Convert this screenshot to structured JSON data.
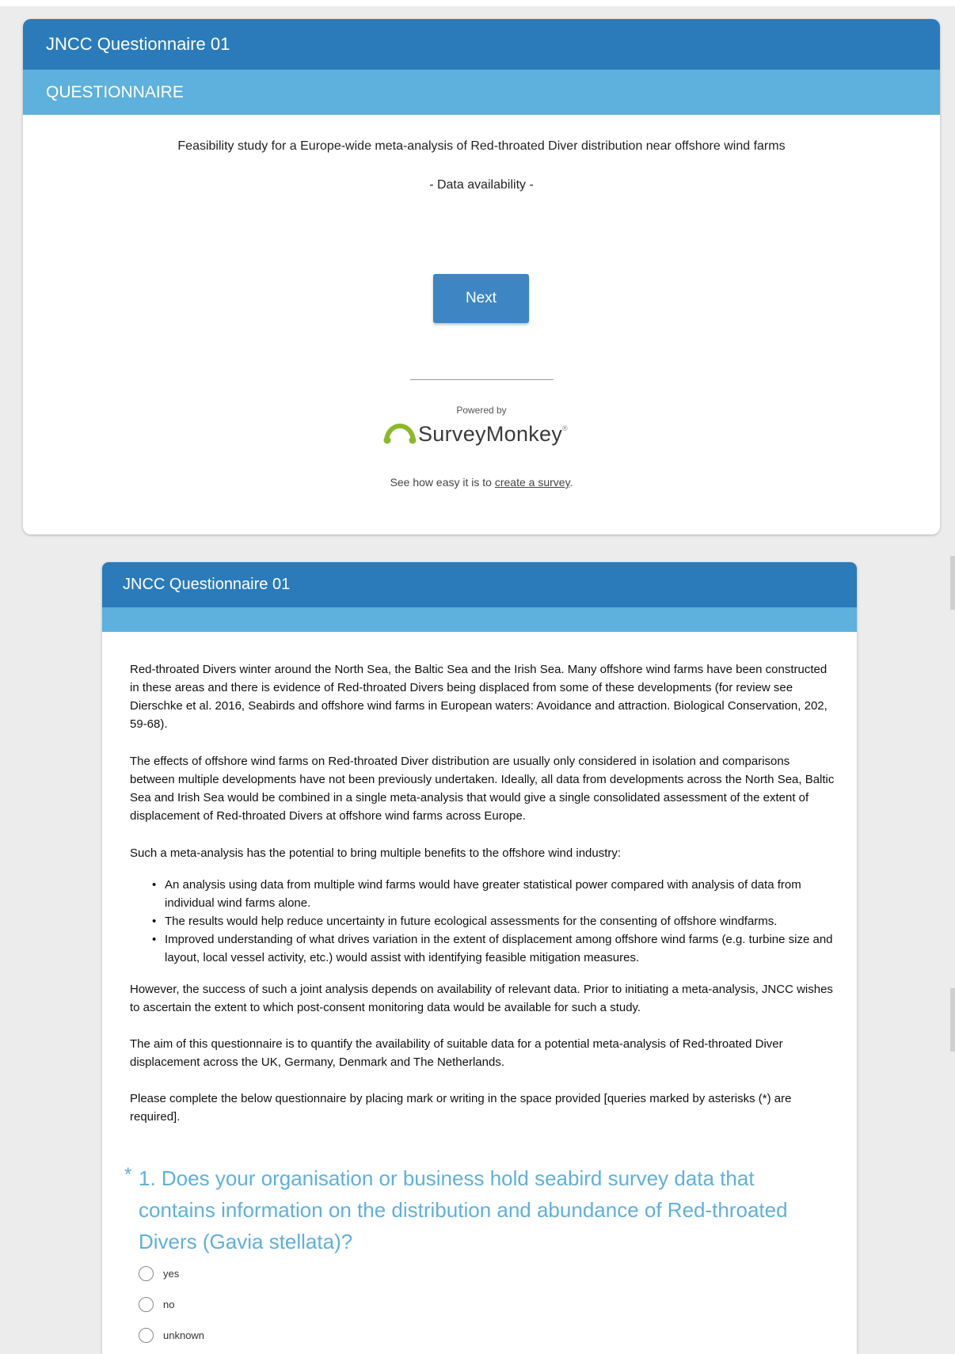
{
  "survey_title": "JNCC Questionnaire 01",
  "page1": {
    "page_title": "QUESTIONNAIRE",
    "intro_line": "Feasibility study for a Europe-wide meta-analysis of Red-throated Diver distribution near offshore wind farms",
    "subtitle": "- Data availability -",
    "next_button": "Next",
    "powered_by": "Powered by",
    "brand": "SurveyMonkey",
    "brand_mark": "®",
    "promo_prefix": "See how easy it is to ",
    "promo_link": "create a survey",
    "promo_suffix": "."
  },
  "page2": {
    "paragraphs": [
      "Red-throated Divers winter around the North Sea, the Baltic Sea and the Irish Sea. Many offshore wind farms have been constructed in these areas and there is evidence of Red-throated Divers being displaced from some of these developments (for review see Dierschke et al. 2016, Seabirds and offshore wind farms in European waters: Avoidance and attraction. Biological Conservation, 202, 59-68).",
      "The effects of offshore wind farms on Red-throated Diver distribution are usually only considered in isolation and comparisons between multiple developments have not been previously undertaken. Ideally, all data from developments across the North Sea, Baltic Sea and Irish Sea would be combined in a single meta-analysis that would give a single consolidated assessment of the extent of displacement of Red-throated Divers at offshore wind farms across Europe.",
      "Such a meta-analysis has the potential to bring multiple benefits to the offshore wind industry:"
    ],
    "bullets": [
      "An analysis using data from multiple wind farms would have greater statistical power compared with analysis of data from individual wind farms alone.",
      "The results would help reduce uncertainty in future ecological assessments for the consenting of offshore windfarms.",
      "Improved understanding of what drives variation in the extent of displacement among offshore wind farms (e.g. turbine size and layout, local vessel activity, etc.) would assist with identifying feasible mitigation measures."
    ],
    "paragraphs_after": [
      "However, the success of such a joint analysis depends on availability of relevant data. Prior to initiating a meta-analysis, JNCC wishes to ascertain the extent to which post-consent monitoring data would be available for such a study.",
      "The aim of this questionnaire is to quantify the availability of suitable data for a potential meta-analysis of Red-throated Diver displacement across the UK, Germany, Denmark and The Netherlands.",
      "Please complete the below questionnaire by placing mark or writing in the space provided [queries marked by asterisks (*) are required]."
    ],
    "question1": {
      "required_marker": "*",
      "text": "1. Does your organisation or business hold seabird survey data that contains information on the distribution and abundance of Red-throated Divers (Gavia stellata)?",
      "options": [
        "yes",
        "no",
        "unknown"
      ]
    }
  },
  "colors": {
    "header_dark": "#2b7bba",
    "header_light": "#5eb0dd",
    "button": "#3e86c3",
    "question_text": "#5eb0dd",
    "brand_green": "#8cb82b"
  },
  "icons": {
    "brand_logo": "surveymonkey-logo-icon",
    "radio": "radio-unchecked-icon"
  }
}
